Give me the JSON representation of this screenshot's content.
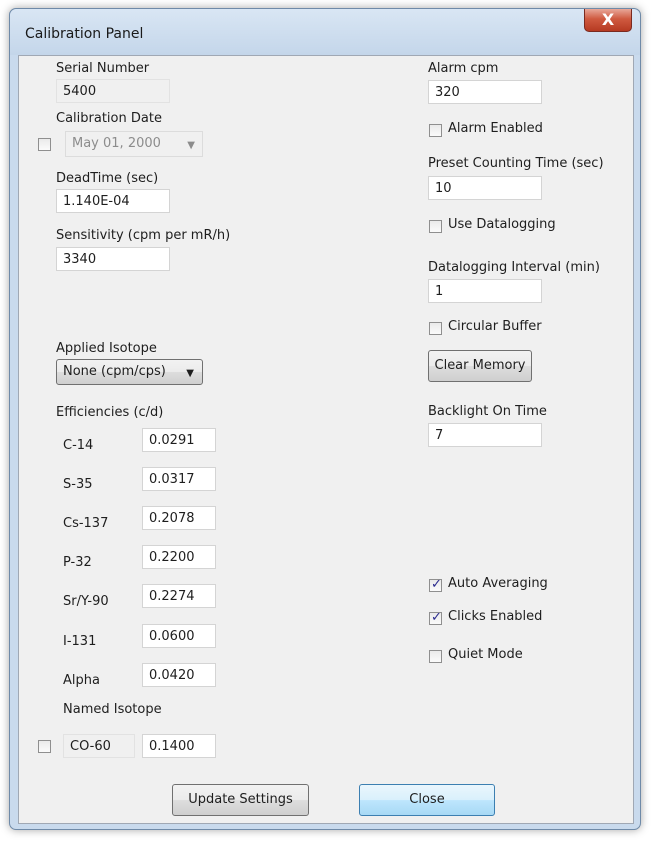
{
  "window": {
    "title": "Calibration Panel",
    "close_glyph": "X"
  },
  "left": {
    "serial_number_label": "Serial Number",
    "serial_number_value": "5400",
    "calibration_date_label": "Calibration Date",
    "calibration_date_value": "May 01, 2000",
    "calibration_date_checked": false,
    "deadtime_label": "DeadTime (sec)",
    "deadtime_value": "1.140E-04",
    "sensitivity_label": "Sensitivity (cpm per mR/h)",
    "sensitivity_value": "3340",
    "applied_isotope_label": "Applied Isotope",
    "applied_isotope_value": "None (cpm/cps)",
    "efficiencies_label": "Efficiencies (c/d)",
    "efficiencies": [
      {
        "isotope": "C-14",
        "value": "0.0291"
      },
      {
        "isotope": "S-35",
        "value": "0.0317"
      },
      {
        "isotope": "Cs-137",
        "value": "0.2078"
      },
      {
        "isotope": "P-32",
        "value": "0.2200"
      },
      {
        "isotope": "Sr/Y-90",
        "value": "0.2274"
      },
      {
        "isotope": "I-131",
        "value": "0.0600"
      },
      {
        "isotope": "Alpha",
        "value": "0.0420"
      }
    ],
    "named_isotope_label": "Named Isotope",
    "named_isotope_name": "CO-60",
    "named_isotope_value": "0.1400",
    "named_isotope_checked": false
  },
  "right": {
    "alarm_cpm_label": "Alarm cpm",
    "alarm_cpm_value": "320",
    "alarm_enabled_label": "Alarm Enabled",
    "alarm_enabled_checked": false,
    "preset_time_label": "Preset Counting Time (sec)",
    "preset_time_value": "10",
    "use_datalogging_label": "Use Datalogging",
    "use_datalogging_checked": false,
    "datalogging_interval_label": "Datalogging Interval (min)",
    "datalogging_interval_value": "1",
    "circular_buffer_label": "Circular Buffer",
    "circular_buffer_checked": false,
    "clear_memory_label": "Clear Memory",
    "backlight_label": "Backlight On Time",
    "backlight_value": "7",
    "auto_averaging_label": "Auto Averaging",
    "auto_averaging_checked": true,
    "clicks_enabled_label": "Clicks Enabled",
    "clicks_enabled_checked": true,
    "quiet_mode_label": "Quiet Mode",
    "quiet_mode_checked": false
  },
  "buttons": {
    "update_settings": "Update Settings",
    "close": "Close"
  }
}
